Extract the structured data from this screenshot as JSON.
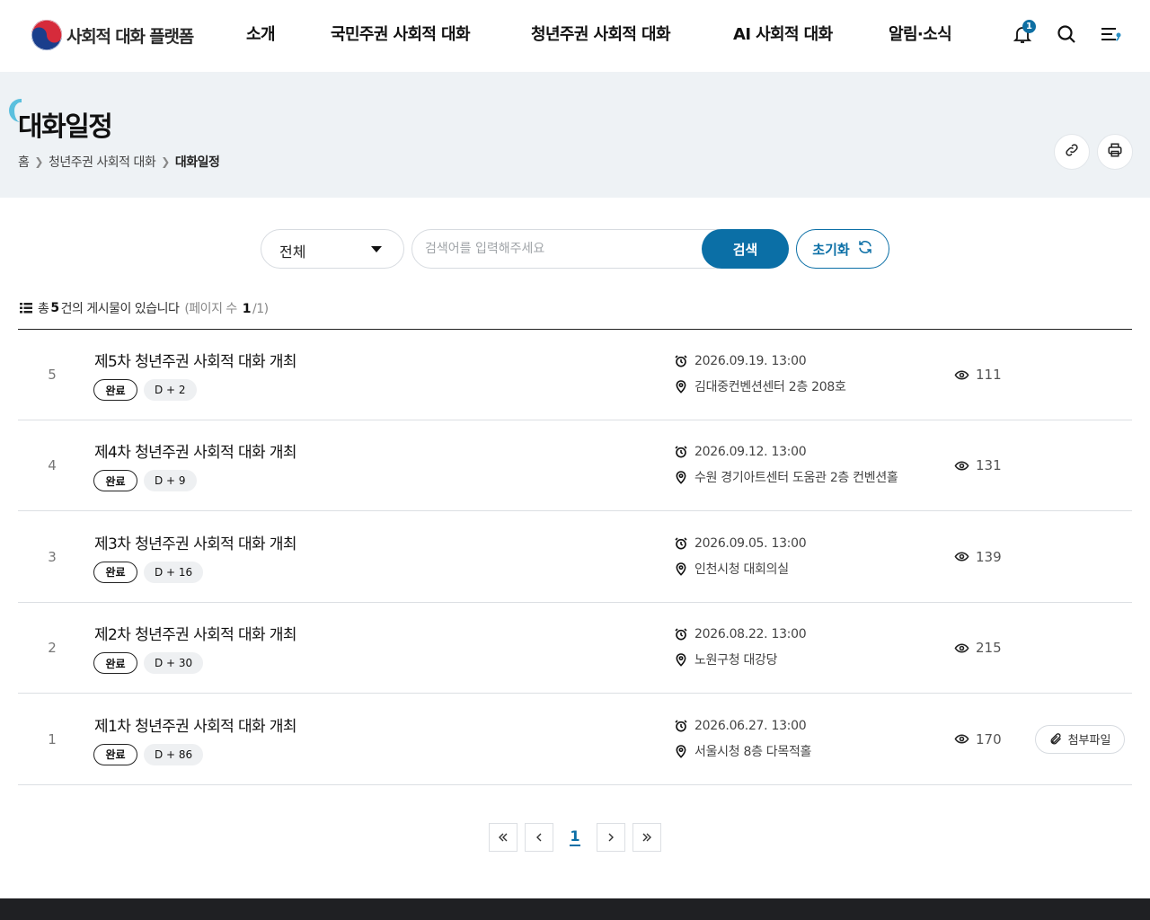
{
  "header": {
    "logo_text": "사회적 대화 플랫폼",
    "nav": [
      "소개",
      "국민주권 사회적 대화",
      "청년주권 사회적 대화",
      "AI 사회적 대화",
      "알림·소식"
    ],
    "active_nav": "청년주권 사회적 대화",
    "notification_count": "1",
    "icons": [
      "bell-icon",
      "search-icon",
      "menu-icon"
    ]
  },
  "page": {
    "title": "대화일정",
    "breadcrumb": [
      "홈",
      "청년주권 사회적 대화",
      "대화일정"
    ]
  },
  "search": {
    "category_selected": "전체",
    "placeholder": "검색어를 입력해주세요",
    "search_label": "검색",
    "reset_label": "초기화"
  },
  "summary": {
    "prefix": "총",
    "total": "5",
    "suffix": "건의 게시물이 있습니다",
    "page_open": "(페이지 수",
    "page_current": "1",
    "page_rest": "/1)"
  },
  "items": [
    {
      "num": "5",
      "title": "제5차 청년주권 사회적 대화 개최",
      "status": "완료",
      "dday": "D + 2",
      "datetime": "2026.09.19. 13:00",
      "place": "김대중컨벤션센터 2층 208호",
      "views": "111",
      "attachment": ""
    },
    {
      "num": "4",
      "title": "제4차 청년주권 사회적 대화 개최",
      "status": "완료",
      "dday": "D + 9",
      "datetime": "2026.09.12. 13:00",
      "place": "수원 경기아트센터 도움관 2층 컨벤션홀",
      "views": "131",
      "attachment": ""
    },
    {
      "num": "3",
      "title": "제3차 청년주권 사회적 대화 개최",
      "status": "완료",
      "dday": "D + 16",
      "datetime": "2026.09.05. 13:00",
      "place": "인천시청 대회의실",
      "views": "139",
      "attachment": ""
    },
    {
      "num": "2",
      "title": "제2차 청년주권 사회적 대화 개최",
      "status": "완료",
      "dday": "D + 30",
      "datetime": "2026.08.22. 13:00",
      "place": "노원구청 대강당",
      "views": "215",
      "attachment": ""
    },
    {
      "num": "1",
      "title": "제1차 청년주권 사회적 대화 개최",
      "status": "완료",
      "dday": "D + 86",
      "datetime": "2026.06.27. 13:00",
      "place": "서울시청 8층 다목적홀",
      "views": "170",
      "attachment": "첨부파일"
    }
  ],
  "pagination": {
    "current": "1"
  },
  "colors": {
    "accent": "#0b6fa6",
    "highlight": "#7dd3e8",
    "title_bg": "#eef2f5"
  }
}
